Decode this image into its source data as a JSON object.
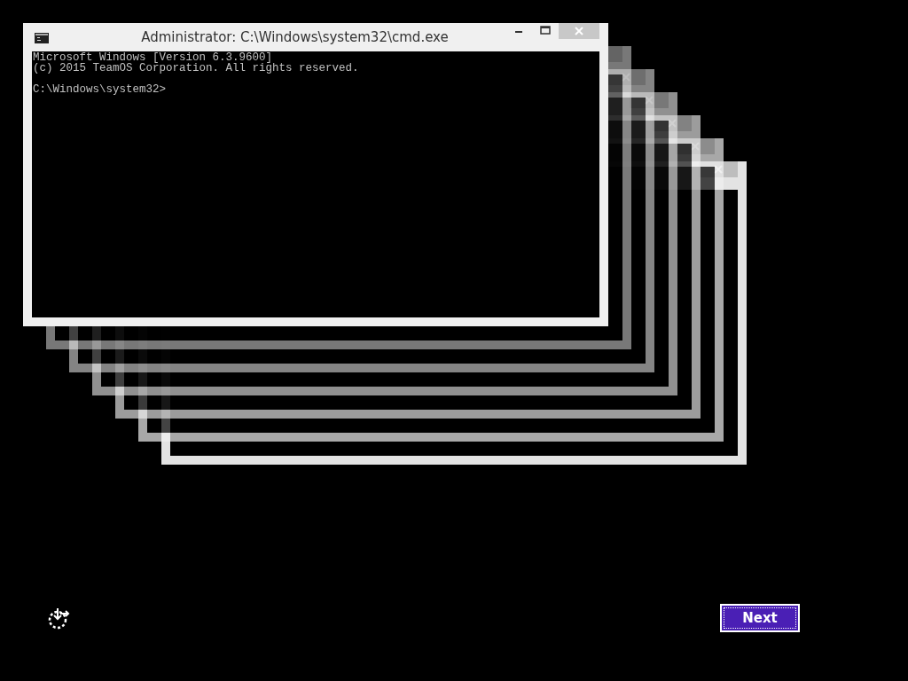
{
  "window": {
    "title": "Administrator: C:\\Windows\\system32\\cmd.exe",
    "console_blocks": [
      [
        "Microsoft Windows [Version 6.3.9600]",
        "(c) 2015 TeamOS Corporation. All rights reserved."
      ],
      [
        "C:\\Windows\\system32>"
      ]
    ]
  },
  "buttons": [
    {
      "label": "Next"
    }
  ]
}
